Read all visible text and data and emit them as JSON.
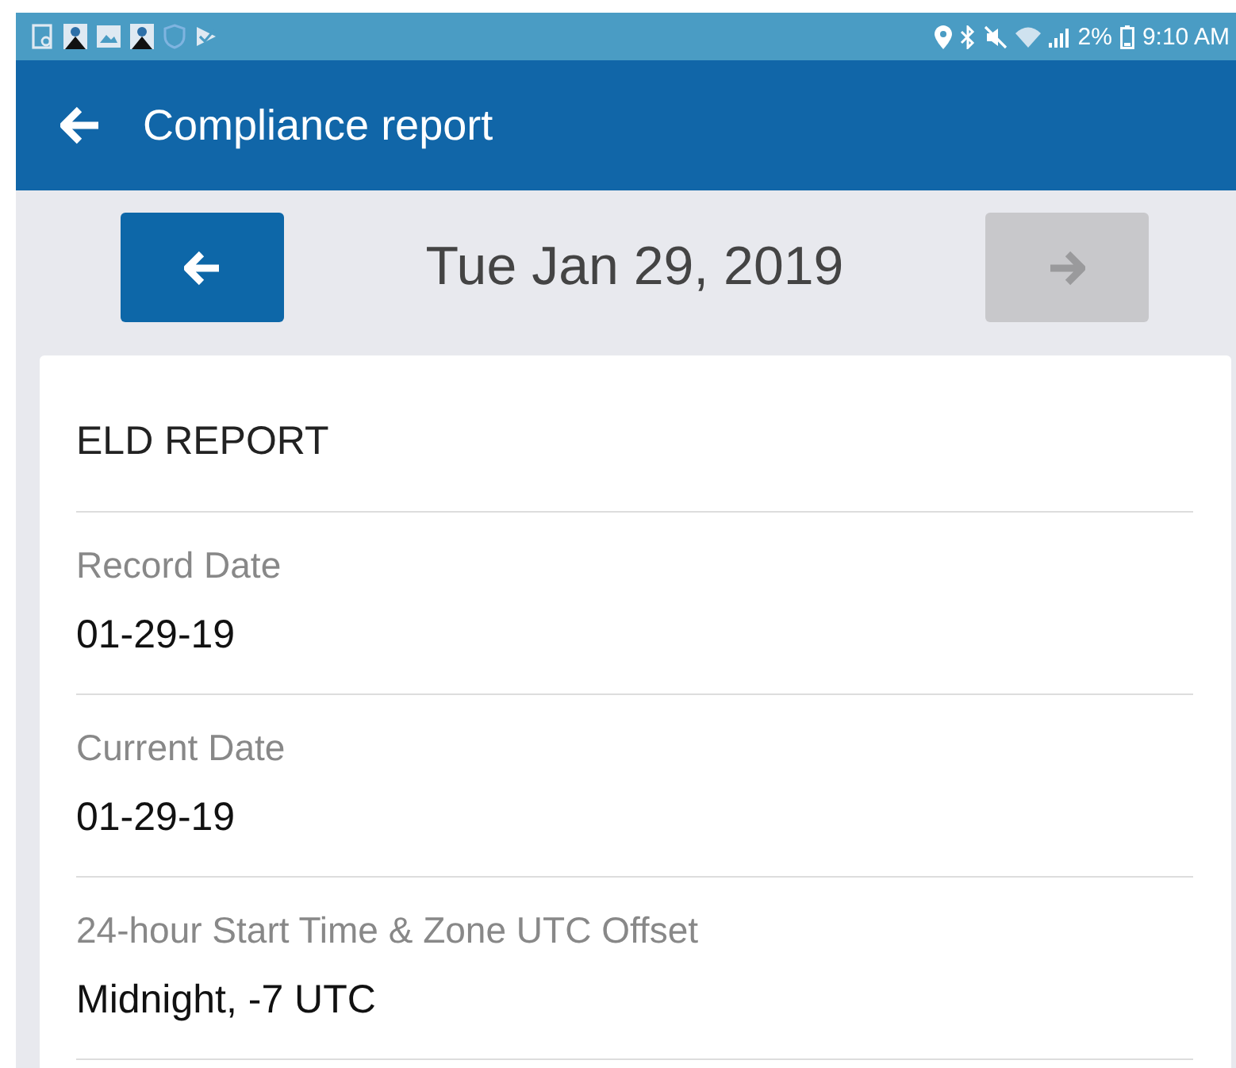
{
  "status_bar": {
    "battery": "2%",
    "time": "9:10 AM"
  },
  "app_bar": {
    "title": "Compliance report"
  },
  "date_nav": {
    "date": "Tue Jan 29, 2019",
    "prev": {
      "disabled": false
    },
    "next": {
      "disabled": true
    }
  },
  "card": {
    "title": "ELD REPORT",
    "fields": [
      {
        "label": "Record Date",
        "value": "01-29-19"
      },
      {
        "label": "Current Date",
        "value": "01-29-19"
      },
      {
        "label": "24-hour Start Time & Zone UTC Offset",
        "value": "Midnight, -7 UTC"
      }
    ]
  }
}
